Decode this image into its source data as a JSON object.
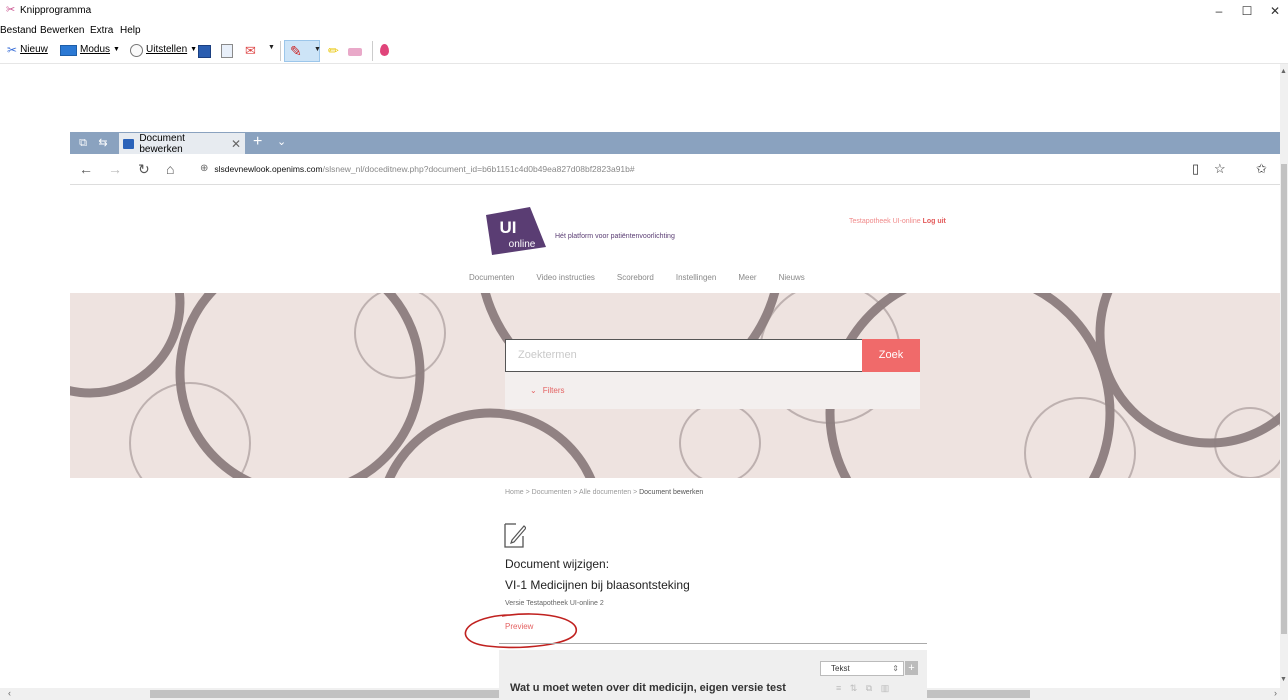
{
  "window": {
    "title": "Knipprogramma",
    "controls": [
      "–",
      "☐",
      "✕"
    ]
  },
  "menu": [
    "Bestand",
    "Bewerken",
    "Extra",
    "Help"
  ],
  "toolbar": {
    "new_label": "Nieuw",
    "mode_label": "Modus",
    "delay_label": "Uitstellen"
  },
  "browser": {
    "tab_title": "Document bewerken",
    "url_host": "slsdevnewlook.openims.com",
    "url_path": "/slsnew_nl/doceditnew.php?document_id=b6b1151c4d0b49ea827d08bf2823a91b#"
  },
  "site": {
    "logo_text_top": "UI",
    "logo_text_bottom": "online",
    "tagline": "Hét platform voor patiëntenvoorlichting",
    "account_name": "Testapotheek UI-online",
    "logout_label": "Log uit",
    "nav": [
      "Documenten",
      "Video instructies",
      "Scorebord",
      "Instellingen",
      "Meer",
      "Nieuws"
    ],
    "search": {
      "placeholder": "Zoektermen",
      "button_label": "Zoek",
      "filters_label": "Filters"
    },
    "breadcrumb": [
      "Home",
      "Documenten",
      "Alle documenten",
      "Document bewerken"
    ],
    "doc_label": "Document wijzigen:",
    "doc_title": "VI-1 Medicijnen bij blaasontsteking",
    "version": "Versie Testapotheek UI-online 2",
    "preview_label": "Preview",
    "editor": {
      "type_select": "Tekst",
      "section_title": "Wat u moet weten over dit medicijn, eigen versie test"
    }
  },
  "colors": {
    "accent": "#f06a6a",
    "brand_purple": "#5a3d73",
    "tab_strip": "#8aa2bf"
  }
}
